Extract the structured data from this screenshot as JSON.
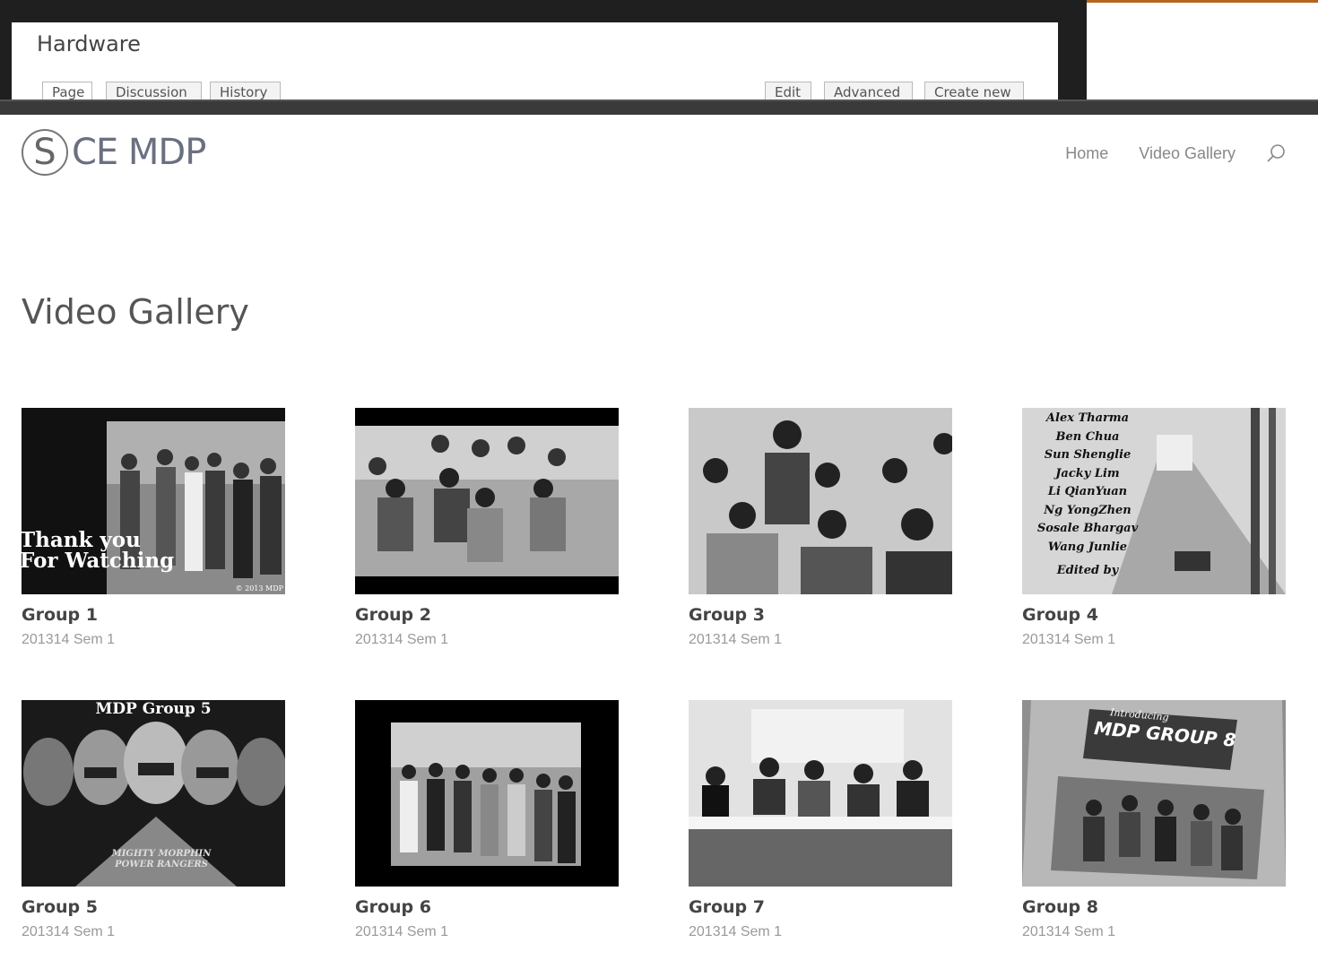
{
  "wiki": {
    "title": "Hardware",
    "tabs": [
      "Page",
      "Discussion",
      "History"
    ],
    "actions": [
      "Edit",
      "Advanced",
      "Create new"
    ]
  },
  "site": {
    "logo_letter": "S",
    "logo_text": "CE MDP",
    "nav": [
      "Home",
      "Video Gallery"
    ],
    "page_title": "Video Gallery"
  },
  "gallery": [
    {
      "title": "Group 1",
      "subtitle": "201314 Sem 1",
      "overlay": "Thank you\nFor Watching",
      "watermark": "© 2013 MDP"
    },
    {
      "title": "Group 2",
      "subtitle": "201314 Sem 1"
    },
    {
      "title": "Group 3",
      "subtitle": "201314 Sem 1"
    },
    {
      "title": "Group 4",
      "subtitle": "201314 Sem 1",
      "credits": [
        "Alex Tharma",
        "Ben Chua",
        "Sun Shenglie",
        "Jacky Lim",
        "Li QianYuan",
        "Ng YongZhen",
        "Sosale Bhargav",
        "Wang Junlie",
        "Edited by"
      ]
    },
    {
      "title": "Group 5",
      "subtitle": "201314 Sem 1",
      "overlay": "MDP Group 5",
      "logo": "MIGHTY MORPHIN POWER RANGERS"
    },
    {
      "title": "Group 6",
      "subtitle": "201314 Sem 1"
    },
    {
      "title": "Group 7",
      "subtitle": "201314 Sem 1"
    },
    {
      "title": "Group 8",
      "subtitle": "201314 Sem 1",
      "overlay_small": "Introducing",
      "overlay": "MDP GROUP 8"
    }
  ],
  "colors": {
    "accent": "#b5651d",
    "text": "#444444",
    "muted": "#999999"
  }
}
